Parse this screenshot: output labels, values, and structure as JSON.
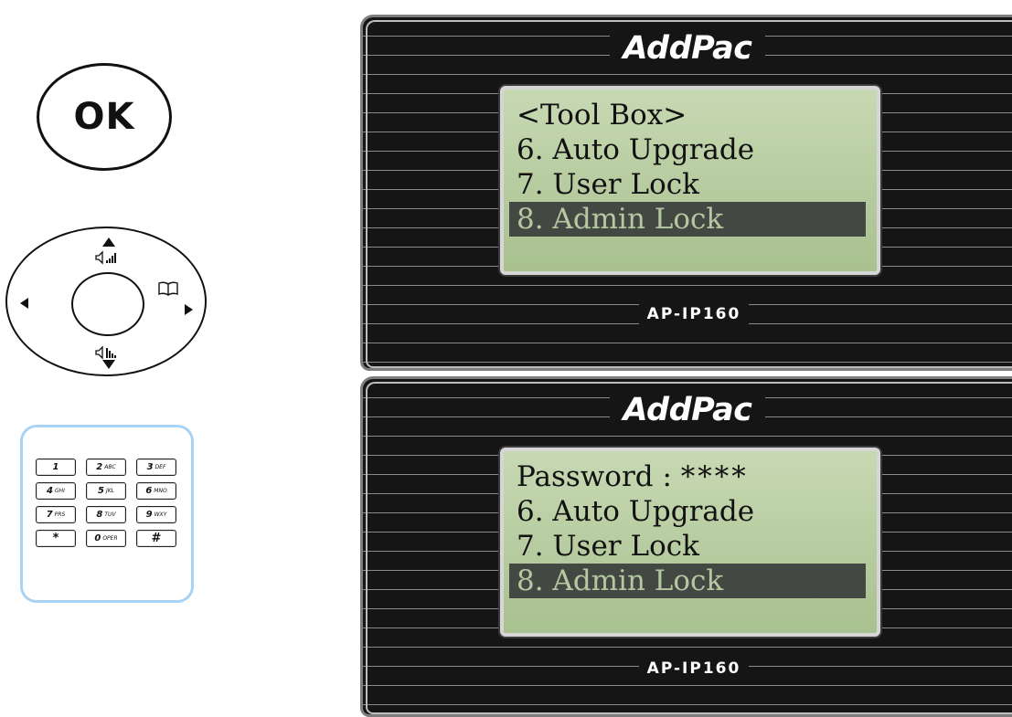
{
  "ok_button": {
    "label": "OK"
  },
  "keypad": {
    "keys": [
      {
        "digit": "1",
        "letters": ""
      },
      {
        "digit": "2",
        "letters": "ABC"
      },
      {
        "digit": "3",
        "letters": "DEF"
      },
      {
        "digit": "4",
        "letters": "GHI"
      },
      {
        "digit": "5",
        "letters": "JKL"
      },
      {
        "digit": "6",
        "letters": "MNO"
      },
      {
        "digit": "7",
        "letters": "PRS"
      },
      {
        "digit": "8",
        "letters": "TUV"
      },
      {
        "digit": "9",
        "letters": "WXY"
      },
      {
        "digit": "*",
        "letters": ""
      },
      {
        "digit": "0",
        "letters": "OPER"
      },
      {
        "digit": "#",
        "letters": ""
      }
    ]
  },
  "screens": [
    {
      "brand": "AddPac",
      "model": "AP-IP160",
      "lines": [
        {
          "text": "<Tool Box>"
        },
        {
          "text": "6. Auto Upgrade"
        },
        {
          "text": "7. User Lock"
        },
        {
          "text": "8. Admin Lock"
        }
      ],
      "selected_line": 4
    },
    {
      "brand": "AddPac",
      "model": "AP-IP160",
      "password_label": "Password : ",
      "password_mask": "****",
      "lines": [
        {
          "text": "6. Auto Upgrade"
        },
        {
          "text": "7. User Lock"
        },
        {
          "text": "8. Admin Lock"
        }
      ],
      "selected_line": 4
    }
  ],
  "colors": {
    "keypad_border": "#a9d3f5",
    "lcd_background": "#b8cc9f",
    "lcd_highlight": "#434843",
    "panel_background": "#151515"
  },
  "icons": {
    "nav_up": "volume-up-icon",
    "nav_down": "volume-down-icon",
    "nav_right": "phonebook-icon"
  }
}
